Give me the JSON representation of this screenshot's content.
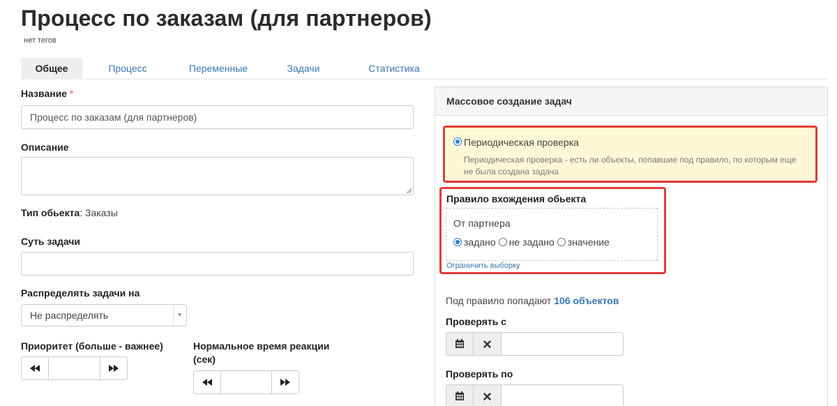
{
  "header": {
    "title": "Процесс по заказам (для партнеров)",
    "tags": "нет тегов"
  },
  "tabs": [
    {
      "label": "Общее",
      "active": true
    },
    {
      "label": "Процесс",
      "active": false
    },
    {
      "label": "Переменные",
      "active": false
    },
    {
      "label": "Задачи",
      "active": false
    },
    {
      "label": "Статистика",
      "active": false
    }
  ],
  "form": {
    "name_label": "Название",
    "required_mark": "*",
    "name_value": "Процесс по заказам (для партнеров)",
    "description_label": "Описание",
    "object_type_label": "Тип обьекта",
    "object_type_value": ": Заказы",
    "task_essence_label": "Суть задачи",
    "distribute_label": "Распределять задачи на",
    "distribute_value": "Не распределять",
    "priority_label": "Приоритет (больше - важнее)",
    "reaction_time_label_line1": "Нормальное время реакции",
    "reaction_time_label_line2": "(сек)"
  },
  "mass_panel": {
    "title": "Массовое создание задач",
    "periodic_label": "Периодическая проверка",
    "periodic_desc_line1": "Периодическая проверка - есть ли объекты, попавшие под правило, по которым еще",
    "periodic_desc_line2": "не была создана задача",
    "rule_title": "Правило вхождения обьекта",
    "rule_field": "От партнера",
    "rule_options": [
      {
        "label": "задано",
        "checked": true
      },
      {
        "label": "не задано",
        "checked": false
      },
      {
        "label": "значение",
        "checked": false
      }
    ],
    "limit_link": "Ограничить выборку",
    "count_prefix": "Под правило попадают",
    "count_value": "106 объектов",
    "check_from_label": "Проверять с",
    "check_to_label": "Проверять по"
  },
  "colors": {
    "accent": "#3a77b0",
    "highlight_border": "#e03c36",
    "highlight_bg": "#fcf8d6"
  }
}
